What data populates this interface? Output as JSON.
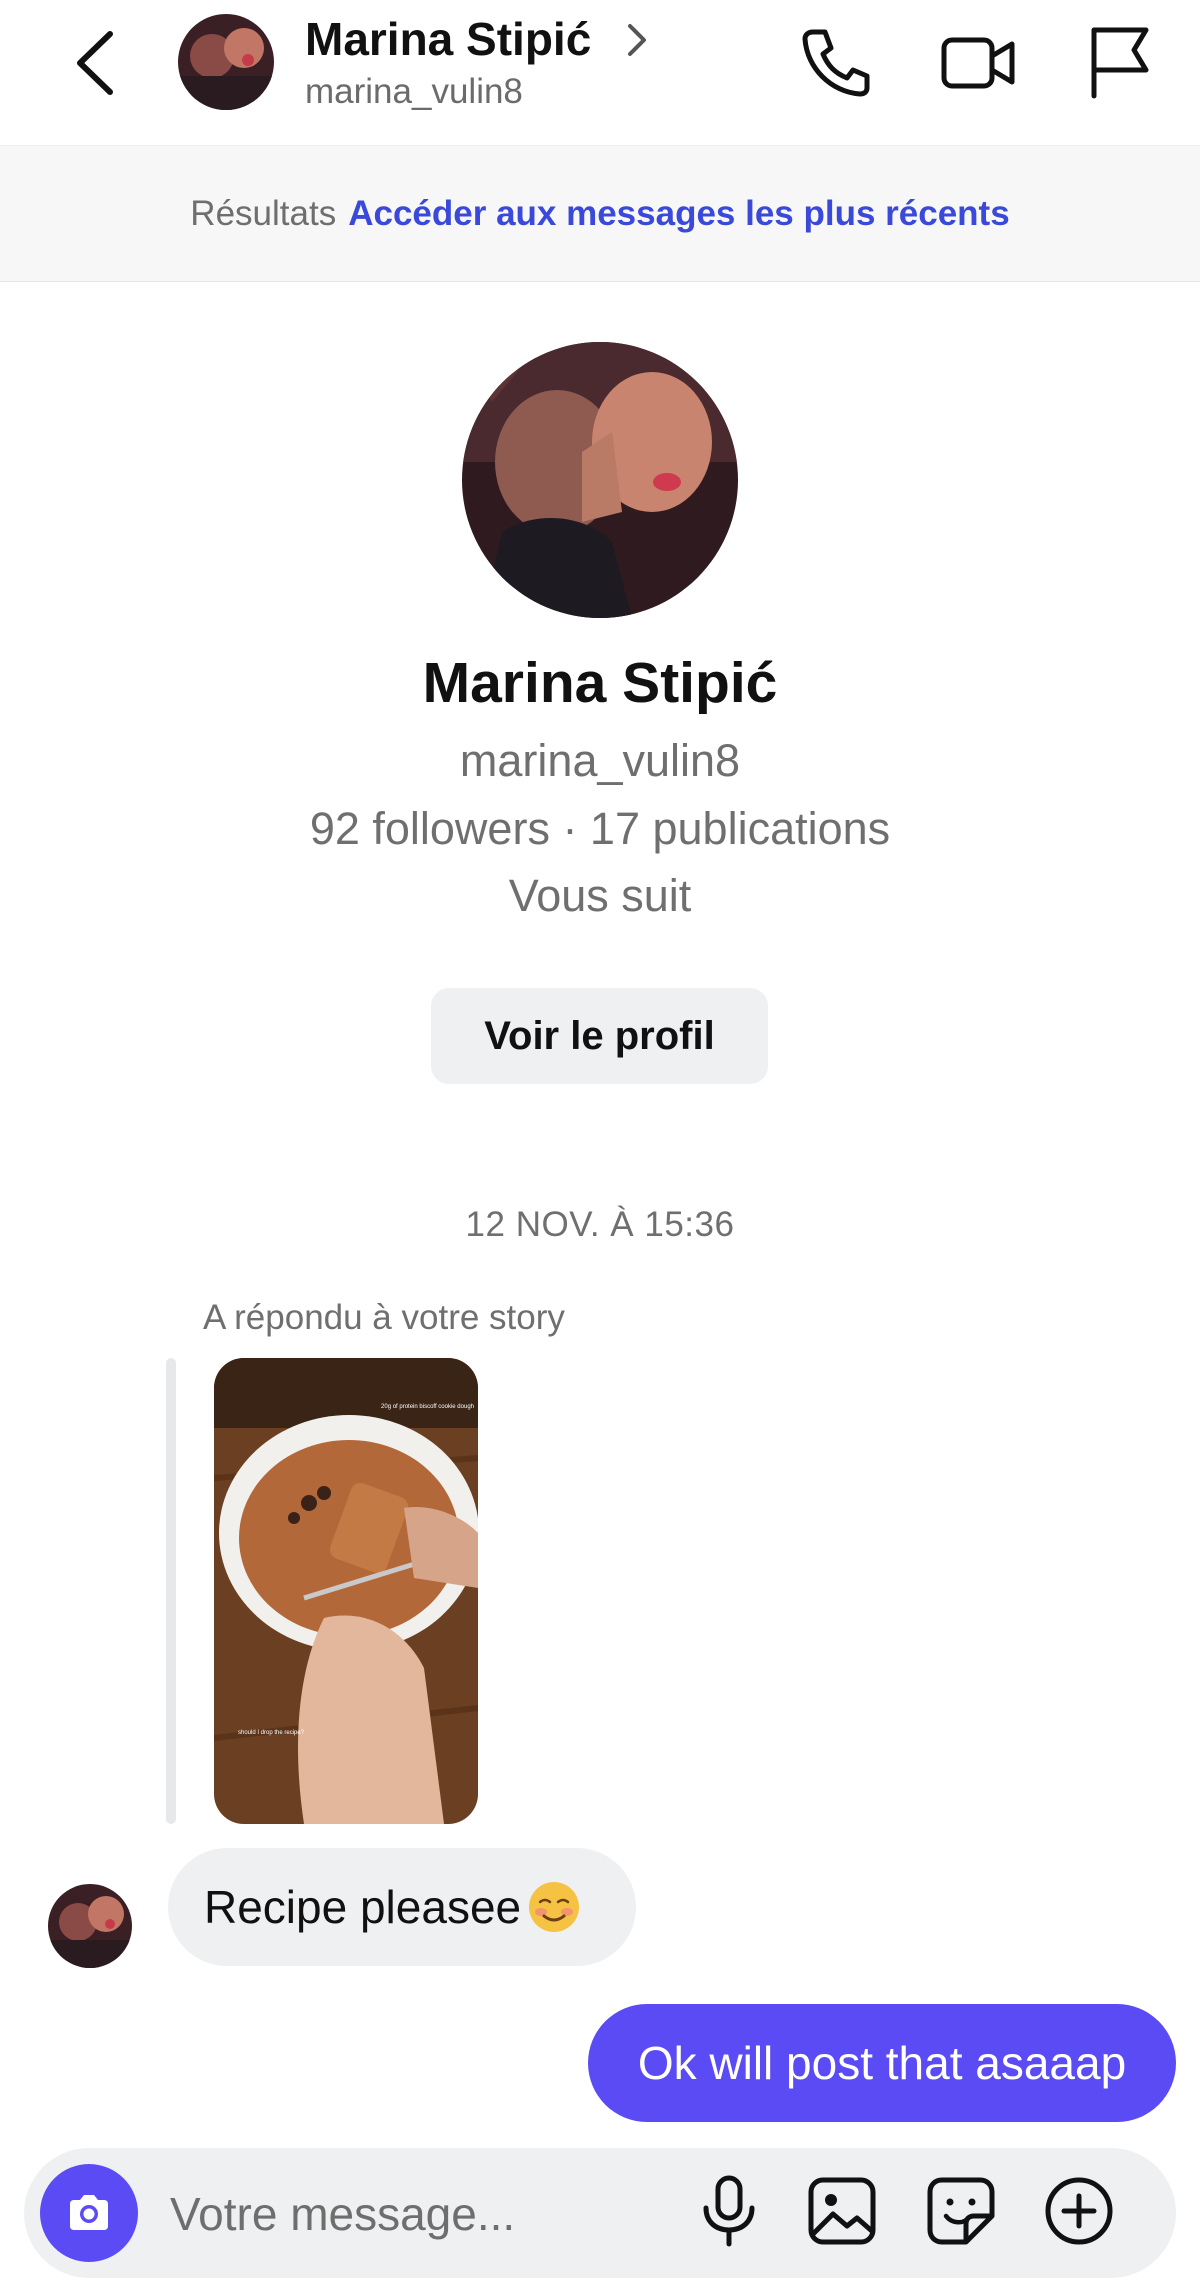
{
  "header": {
    "name": "Marina Stipić",
    "username": "marina_vulin8"
  },
  "results_bar": {
    "label": "Résultats",
    "link": "Accéder aux messages les plus récents"
  },
  "profile": {
    "name": "Marina Stipić",
    "username": "marina_vulin8",
    "stats": "92 followers · 17 publications",
    "follow_status": "Vous suit",
    "view_profile_button": "Voir le profil"
  },
  "conversation": {
    "timestamp": "12 NOV. À 15:36",
    "story_reply_label": "A répondu à votre story",
    "story_caption_top": "20g of protein biscoff cookie dough",
    "story_caption_bottom": "should I drop the recipe?",
    "messages": [
      {
        "from": "them",
        "text": "Recipe pleasee",
        "emoji": "smiling-blush-emoji"
      },
      {
        "from": "me",
        "text": "Ok will post that asaaap"
      }
    ]
  },
  "composer": {
    "placeholder": "Votre message..."
  },
  "colors": {
    "accent": "#5b4bf5",
    "link": "#3a49d9",
    "bubble_in": "#eef0f2"
  },
  "icons": [
    "back-icon",
    "chevron-right-icon",
    "phone-icon",
    "video-icon",
    "flag-icon",
    "camera-icon",
    "microphone-icon",
    "gallery-icon",
    "sticker-icon",
    "plus-icon"
  ]
}
